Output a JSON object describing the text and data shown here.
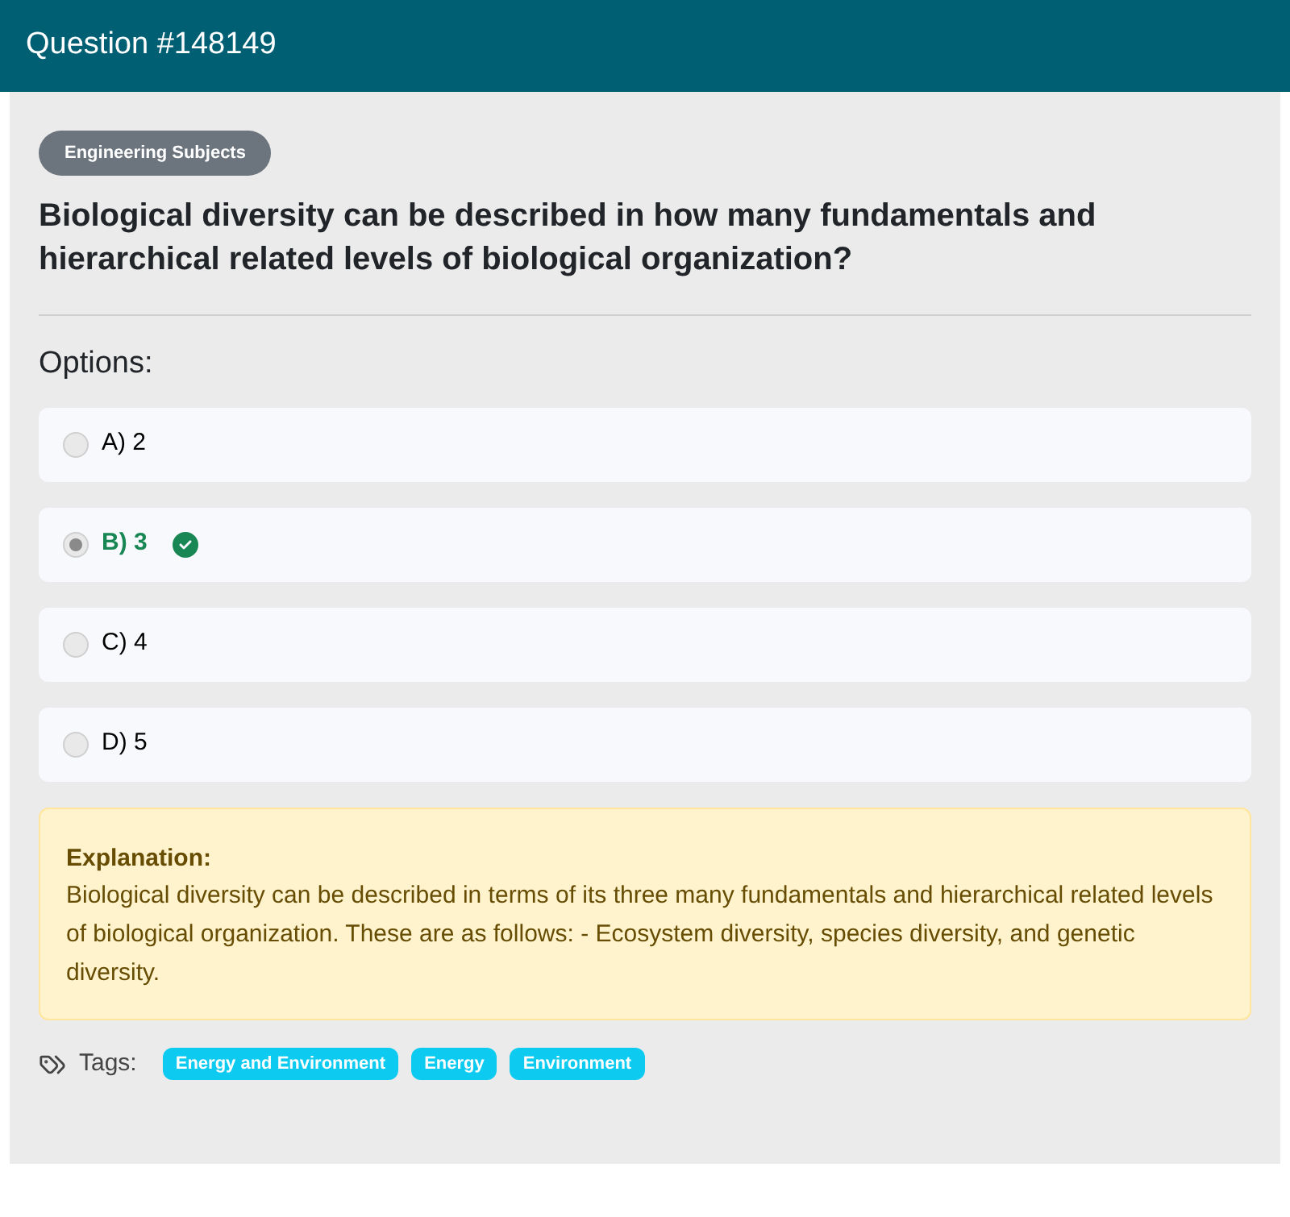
{
  "header": {
    "title": "Question #148149"
  },
  "category": "Engineering Subjects",
  "question": "Biological diversity can be described in how many fundamentals and hierarchical related levels of biological organization?",
  "options_label": "Options:",
  "options": [
    {
      "label": "A) 2",
      "selected": false,
      "correct": false
    },
    {
      "label": "B) 3",
      "selected": true,
      "correct": true
    },
    {
      "label": "C) 4",
      "selected": false,
      "correct": false
    },
    {
      "label": "D) 5",
      "selected": false,
      "correct": false
    }
  ],
  "explanation": {
    "heading": "Explanation:",
    "text": "Biological diversity can be described in terms of its three many fundamentals and hierarchical related levels of biological organization. These are as follows: - Ecosystem diversity, species diversity, and genetic diversity."
  },
  "tags_label": "Tags:",
  "tags": [
    "Energy and Environment",
    "Energy",
    "Environment"
  ]
}
